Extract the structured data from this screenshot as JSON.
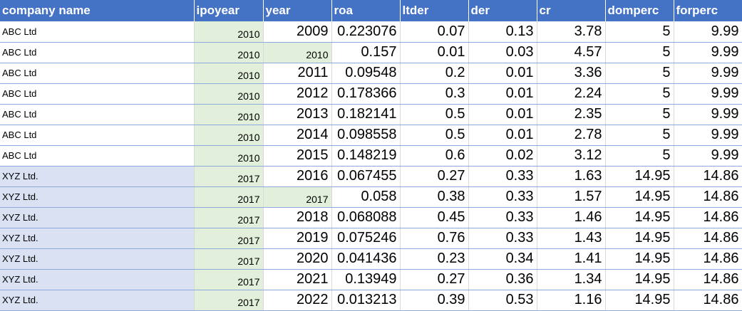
{
  "headers": [
    "company name",
    "ipoyear",
    "year",
    "roa",
    "ltder",
    "der",
    "cr",
    "domperc",
    "forperc"
  ],
  "rows": [
    {
      "company": "ABC Ltd",
      "ipoyear": "2010",
      "year": "2009",
      "roa": "0.223076",
      "ltder": "0.07",
      "der": "0.13",
      "cr": "3.78",
      "domperc": "5",
      "forperc": "9.99"
    },
    {
      "company": "ABC Ltd",
      "ipoyear": "2010",
      "year": "2010",
      "roa": "0.157",
      "ltder": "0.01",
      "der": "0.03",
      "cr": "4.57",
      "domperc": "5",
      "forperc": "9.99"
    },
    {
      "company": "ABC Ltd",
      "ipoyear": "2010",
      "year": "2011",
      "roa": "0.09548",
      "ltder": "0.2",
      "der": "0.01",
      "cr": "3.36",
      "domperc": "5",
      "forperc": "9.99"
    },
    {
      "company": "ABC Ltd",
      "ipoyear": "2010",
      "year": "2012",
      "roa": "0.178366",
      "ltder": "0.3",
      "der": "0.01",
      "cr": "2.24",
      "domperc": "5",
      "forperc": "9.99"
    },
    {
      "company": "ABC Ltd",
      "ipoyear": "2010",
      "year": "2013",
      "roa": "0.182141",
      "ltder": "0.5",
      "der": "0.01",
      "cr": "2.35",
      "domperc": "5",
      "forperc": "9.99"
    },
    {
      "company": "ABC Ltd",
      "ipoyear": "2010",
      "year": "2014",
      "roa": "0.098558",
      "ltder": "0.5",
      "der": "0.01",
      "cr": "2.78",
      "domperc": "5",
      "forperc": "9.99"
    },
    {
      "company": "ABC Ltd",
      "ipoyear": "2010",
      "year": "2015",
      "roa": "0.148219",
      "ltder": "0.6",
      "der": "0.02",
      "cr": "3.12",
      "domperc": "5",
      "forperc": "9.99"
    },
    {
      "company": "XYZ Ltd.",
      "ipoyear": "2017",
      "year": "2016",
      "roa": "0.067455",
      "ltder": "0.27",
      "der": "0.33",
      "cr": "1.63",
      "domperc": "14.95",
      "forperc": "14.86"
    },
    {
      "company": "XYZ Ltd.",
      "ipoyear": "2017",
      "year": "2017",
      "roa": "0.058",
      "ltder": "0.38",
      "der": "0.33",
      "cr": "1.57",
      "domperc": "14.95",
      "forperc": "14.86"
    },
    {
      "company": "XYZ Ltd.",
      "ipoyear": "2017",
      "year": "2018",
      "roa": "0.068088",
      "ltder": "0.45",
      "der": "0.33",
      "cr": "1.46",
      "domperc": "14.95",
      "forperc": "14.86"
    },
    {
      "company": "XYZ Ltd.",
      "ipoyear": "2017",
      "year": "2019",
      "roa": "0.075246",
      "ltder": "0.76",
      "der": "0.33",
      "cr": "1.43",
      "domperc": "14.95",
      "forperc": "14.86"
    },
    {
      "company": "XYZ Ltd.",
      "ipoyear": "2017",
      "year": "2020",
      "roa": "0.041436",
      "ltder": "0.23",
      "der": "0.34",
      "cr": "1.41",
      "domperc": "14.95",
      "forperc": "14.86"
    },
    {
      "company": "XYZ Ltd.",
      "ipoyear": "2017",
      "year": "2021",
      "roa": "0.13949",
      "ltder": "0.27",
      "der": "0.36",
      "cr": "1.34",
      "domperc": "14.95",
      "forperc": "14.86"
    },
    {
      "company": "XYZ Ltd.",
      "ipoyear": "2017",
      "year": "2022",
      "roa": "0.013213",
      "ltder": "0.39",
      "der": "0.53",
      "cr": "1.16",
      "domperc": "14.95",
      "forperc": "14.86"
    }
  ],
  "colors": {
    "header_bg": "#4472c4",
    "ipo_highlight": "#e2efda",
    "xyz_highlight": "#d9e1f2"
  }
}
